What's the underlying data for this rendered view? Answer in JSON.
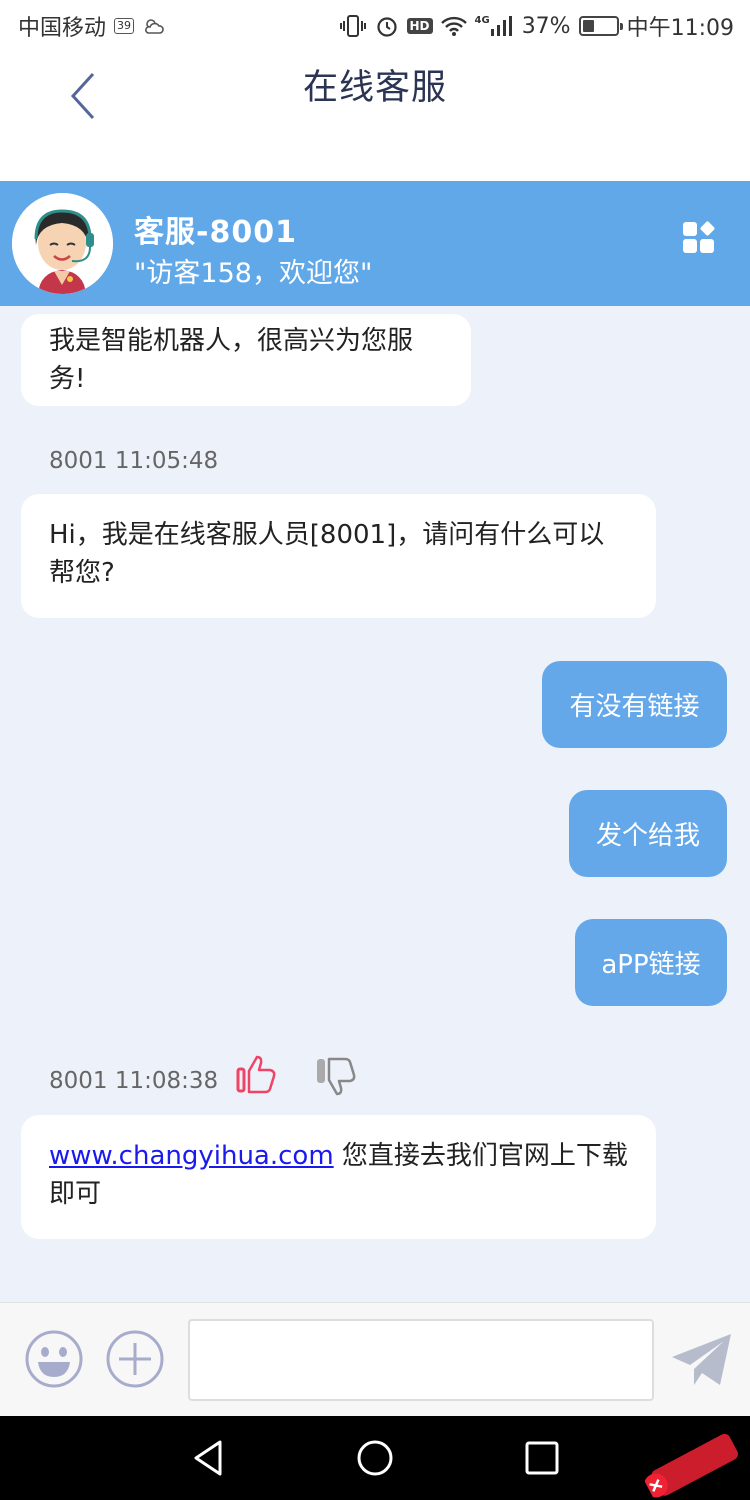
{
  "status_bar": {
    "carrier": "中国移动",
    "sim_badge": "39",
    "network": "4G",
    "hd": "HD",
    "battery_percent": "37%",
    "battery_level": 0.37,
    "time": "中午11:09"
  },
  "title_bar": {
    "title": "在线客服",
    "back_icon": "chevron-left-icon"
  },
  "agent": {
    "name": "客服-8001",
    "greeting": "\"访客158，欢迎您\"",
    "avatar_icon": "customer-service-avatar",
    "menu_icon": "apps-icon"
  },
  "messages": [
    {
      "side": "left",
      "text": "我是智能机器人，很高兴为您服务!"
    },
    {
      "side": "left",
      "timestamp": "8001 11:05:48",
      "text": "Hi，我是在线客服人员[8001]，请问有什么可以帮您?"
    },
    {
      "side": "right",
      "text": "有没有链接"
    },
    {
      "side": "right",
      "text": "发个给我"
    },
    {
      "side": "right",
      "text": "aPP链接"
    },
    {
      "side": "left",
      "timestamp": "8001 11:08:38",
      "link": "www.changyihua.com",
      "text": " 您直接去我们官网上下载即可"
    }
  ],
  "colors": {
    "header_blue": "#61a8e9",
    "bubble_blue": "#64a8ea",
    "chat_bg": "#edf2fa",
    "thumb_up": "#ee4466",
    "title_text": "#2b3553"
  },
  "input": {
    "placeholder": "",
    "emoji_icon": "smiley-icon",
    "plus_icon": "plus-circle-icon",
    "send_icon": "paper-plane-icon"
  },
  "nav": {
    "back_icon": "triangle-back-icon",
    "home_icon": "circle-home-icon",
    "recents_icon": "square-recents-icon"
  }
}
